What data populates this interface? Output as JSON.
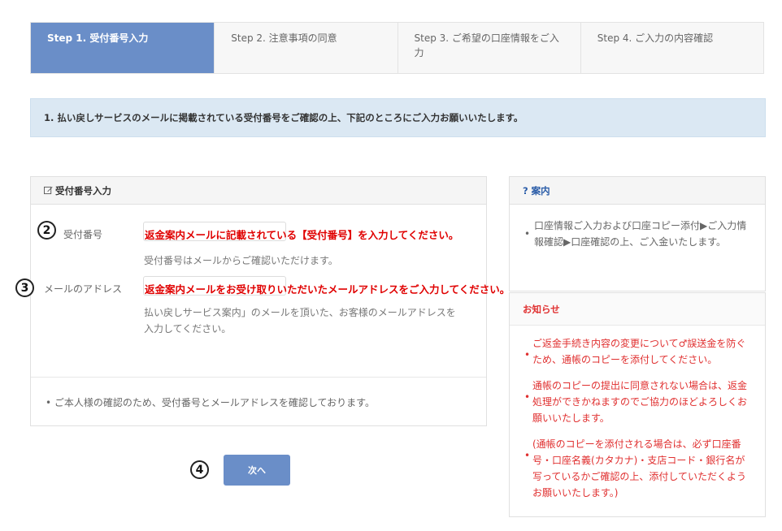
{
  "steps": [
    {
      "label": "Step 1. 受付番号入力",
      "active": true
    },
    {
      "label": "Step 2. 注意事項の同意",
      "active": false
    },
    {
      "label": "Step 3. ご希望の口座情報をご入力",
      "active": false
    },
    {
      "label": "Step 4. ご入力の内容確認",
      "active": false
    }
  ],
  "notice": "1. 払い戻しサービスのメールに掲載されている受付番号をご確認の上、下記のところにご入力お願いいたします。",
  "form": {
    "title": "受付番号入力",
    "receipt_label": "受付番号",
    "receipt_annotation": "返金案内メールに記載されている【受付番号】を入力してください。",
    "receipt_help": "受付番号はメールからご確認いただけます。",
    "email_label": "メールのアドレス",
    "email_annotation": "返金案内メールをお受け取りいただいたメールアドレスをご入力してください。",
    "email_help_1": "払い戻しサービス案内」のメールを頂いた、お客様のメールアドレスを",
    "email_help_2": "入力してください。",
    "footnote": "• ご本人様の確認のため、受付番号とメールアドレスを確認しております。"
  },
  "badges": {
    "two": "2",
    "three": "3",
    "four": "4"
  },
  "next_button": "次へ",
  "guide": {
    "title": "? 案内",
    "bullet": "•",
    "body": "口座情報ご入力および口座コピー添付▶ご入力情報確認▶口座確認の上、ご入金いたします。"
  },
  "news": {
    "title": "お知らせ",
    "bullet": "•",
    "items": [
      "ご返金手続き内容の変更について♂誤送金を防ぐため、通帳のコピーを添付してください。",
      "通帳のコピーの提出に同意されない場合は、返金処理ができかねますのでご協力のほどよろしくお願いいたします。",
      "(通帳のコピーを添付される場合は、必ず口座番号・口座名義(カタカナ)・支店コード・銀行名が写っているかご確認の上、添付していただくようお願いいたします。)"
    ]
  },
  "colors": {
    "accent": "#6a8ec8",
    "notice_bg": "#dbe8f3",
    "annotation_red": "#e00000"
  }
}
